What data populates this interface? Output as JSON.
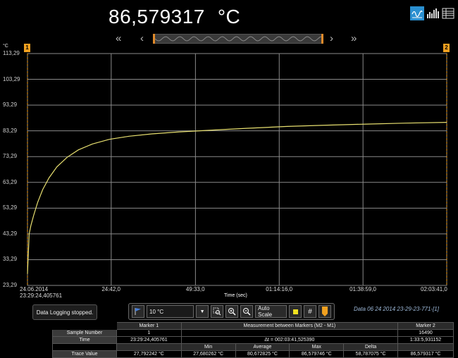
{
  "reading": {
    "value": "86,579317",
    "unit": "°C"
  },
  "view_icons": [
    "line-chart-icon",
    "bar-chart-icon",
    "table-icon"
  ],
  "nav": {
    "first": "«",
    "prev": "‹",
    "next": "›",
    "last": "»"
  },
  "markers": {
    "m1": "1",
    "m2": "2"
  },
  "chart_data": {
    "type": "line",
    "ylabel": "°C",
    "xlabel": "Time (sec)",
    "y_ticks": [
      "113,29",
      "103,29",
      "93,29",
      "83,29",
      "73,29",
      "63,29",
      "53,29",
      "43,29",
      "33,29",
      "23,29"
    ],
    "ylim": [
      23.29,
      113.29
    ],
    "x_ticks": [
      {
        "t": 0,
        "label": "24.06.2014",
        "label2": "23:29:24,405761"
      },
      {
        "t": 1482,
        "label": "24:42,0"
      },
      {
        "t": 2973,
        "label": "49:33,0"
      },
      {
        "t": 4456,
        "label": "01:14:16,0"
      },
      {
        "t": 5939,
        "label": "01:38:59,0"
      },
      {
        "t": 7421,
        "label": "02:03:41,0"
      }
    ],
    "xlim": [
      0,
      7421
    ],
    "grid": true,
    "series": [
      {
        "color": "#e8e070",
        "x": [
          0,
          30,
          60,
          110,
          180,
          270,
          380,
          520,
          700,
          900,
          1150,
          1450,
          1800,
          2200,
          2700,
          3300,
          3900,
          4600,
          5300,
          6000,
          6700,
          7421
        ],
        "y": [
          27.79,
          43.3,
          46.5,
          50.5,
          55.5,
          60.5,
          65.0,
          69.3,
          73.0,
          75.9,
          78.2,
          80.0,
          81.2,
          82.1,
          82.9,
          83.6,
          84.3,
          85.0,
          85.5,
          85.9,
          86.3,
          86.58
        ]
      }
    ]
  },
  "status": "Data Logging stopped.",
  "toolbar": {
    "scale": "10 °C",
    "autoscale": "Auto Scale",
    "grid": "#"
  },
  "data_file": "Data 06 24 2014 23-29-23-771-[1]",
  "table": {
    "header": [
      "",
      "Marker 1",
      "Measurement between Markers (M2 - M1)",
      "Marker 2"
    ],
    "sample": {
      "label": "Sample Number",
      "m1": "1",
      "m2": "16490"
    },
    "time": {
      "label": "Time",
      "m1": "23:29:24,405761",
      "dt": "Δt = 002:03:41,525390",
      "m2": "1:33:5,931152"
    },
    "stat_headers": [
      "Min",
      "Average",
      "Max",
      "Delta"
    ],
    "trace": {
      "label": "Trace Value",
      "m1": "27,792242 °C",
      "min": "27,680262 °C",
      "avg": "80,672825 °C",
      "max": "86,579746 °C",
      "delta": "58,787075 °C",
      "m2": "86,579317 °C"
    }
  }
}
